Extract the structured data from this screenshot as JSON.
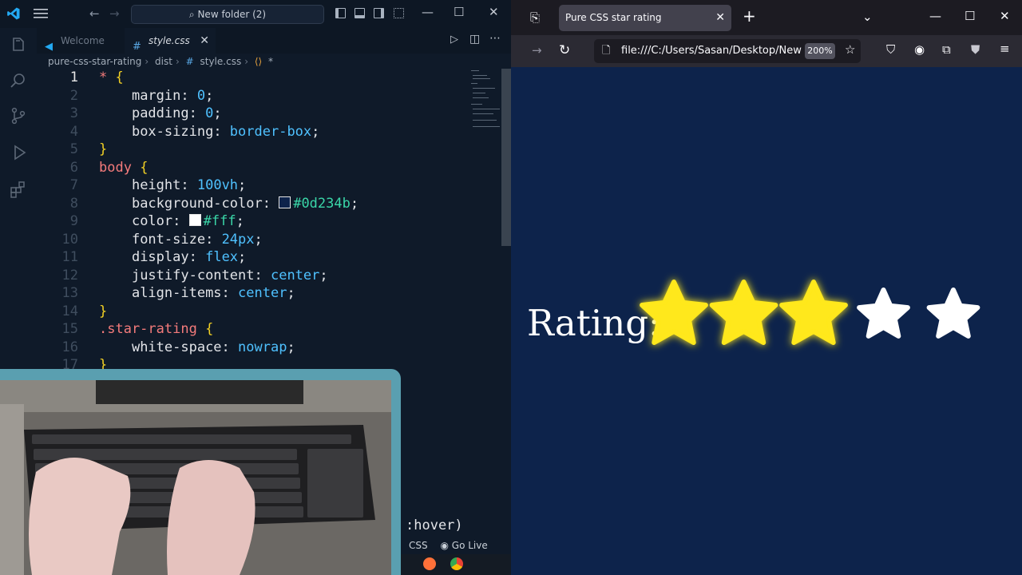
{
  "vscode": {
    "search_label": "New folder (2)",
    "tabs": [
      {
        "label": "Welcome",
        "active": false
      },
      {
        "label": "style.css",
        "active": true
      }
    ],
    "breadcrumb": [
      "pure-css-star-rating",
      "dist",
      "style.css",
      "*"
    ],
    "code": [
      {
        "n": "1",
        "active": true
      },
      {
        "n": "2"
      },
      {
        "n": "3"
      },
      {
        "n": "4"
      },
      {
        "n": "5"
      },
      {
        "n": "6"
      },
      {
        "n": "7"
      },
      {
        "n": "8"
      },
      {
        "n": "9"
      },
      {
        "n": "10"
      },
      {
        "n": "11"
      },
      {
        "n": "12"
      },
      {
        "n": "13"
      },
      {
        "n": "14"
      },
      {
        "n": "15"
      },
      {
        "n": "16"
      },
      {
        "n": "17"
      }
    ],
    "lines": {
      "l1_sel": "*",
      "l1_brace": "{",
      "l2_prop": "margin",
      "l2_val": "0",
      "l3_prop": "padding",
      "l3_val": "0",
      "l4_prop": "box-sizing",
      "l4_val": "border-box",
      "l5_brace": "}",
      "l6_sel": "body",
      "l6_brace": "{",
      "l7_prop": "height",
      "l7_val": "100vh",
      "l8_prop": "background-color",
      "l8_val": "#0d234b",
      "l9_prop": "color",
      "l9_val": "#fff",
      "l10_prop": "font-size",
      "l10_val": "24px",
      "l11_prop": "display",
      "l11_val": "flex",
      "l12_prop": "justify-content",
      "l12_val": "center",
      "l13_prop": "align-items",
      "l13_val": "center",
      "l14_brace": "}",
      "l15_sel": ".star-rating",
      "l15_brace": "{",
      "l16_prop": "white-space",
      "l16_val": "nowrap",
      "l17_brace": "}"
    },
    "partial_code": ":hover)",
    "status": {
      "language": "CSS",
      "golive": "Go Live"
    },
    "colors": {
      "swatch_dark": "#0d234b",
      "swatch_white": "#ffffff"
    }
  },
  "browser": {
    "tab_title": "Pure CSS star rating",
    "url": "file:///C:/Users/Sasan/Desktop/New fo",
    "zoom": "200%",
    "page": {
      "label": "Rating:",
      "stars_filled": 3,
      "stars_total": 5,
      "filled_color": "#ffe81a",
      "empty_color": "#ffffff"
    }
  }
}
